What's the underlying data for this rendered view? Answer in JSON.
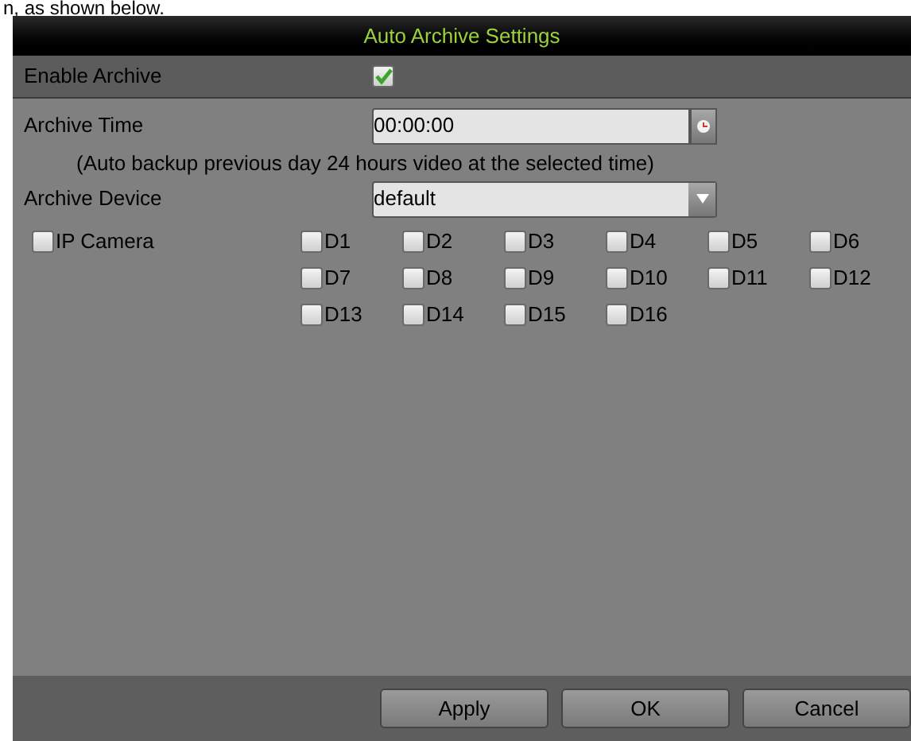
{
  "document_text": "n, as shown below.",
  "dialog": {
    "title": "Auto Archive Settings",
    "enable_archive": {
      "label": "Enable Archive",
      "checked": true
    },
    "archive_time": {
      "label": "Archive Time",
      "value": "00:00:00"
    },
    "note": "(Auto backup previous day 24 hours video at the selected time)",
    "archive_device": {
      "label": "Archive Device",
      "value": "default"
    },
    "ip_camera": {
      "label": "IP Camera",
      "checked": false
    },
    "channels": [
      {
        "label": "D1",
        "checked": false
      },
      {
        "label": "D2",
        "checked": false
      },
      {
        "label": "D3",
        "checked": false
      },
      {
        "label": "D4",
        "checked": false
      },
      {
        "label": "D5",
        "checked": false
      },
      {
        "label": "D6",
        "checked": false
      },
      {
        "label": "D7",
        "checked": false
      },
      {
        "label": "D8",
        "checked": false
      },
      {
        "label": "D9",
        "checked": false
      },
      {
        "label": "D10",
        "checked": false
      },
      {
        "label": "D11",
        "checked": false
      },
      {
        "label": "D12",
        "checked": false
      },
      {
        "label": "D13",
        "checked": false
      },
      {
        "label": "D14",
        "checked": false
      },
      {
        "label": "D15",
        "checked": false
      },
      {
        "label": "D16",
        "checked": false
      }
    ],
    "buttons": [
      "Apply",
      "OK",
      "Cancel"
    ]
  }
}
